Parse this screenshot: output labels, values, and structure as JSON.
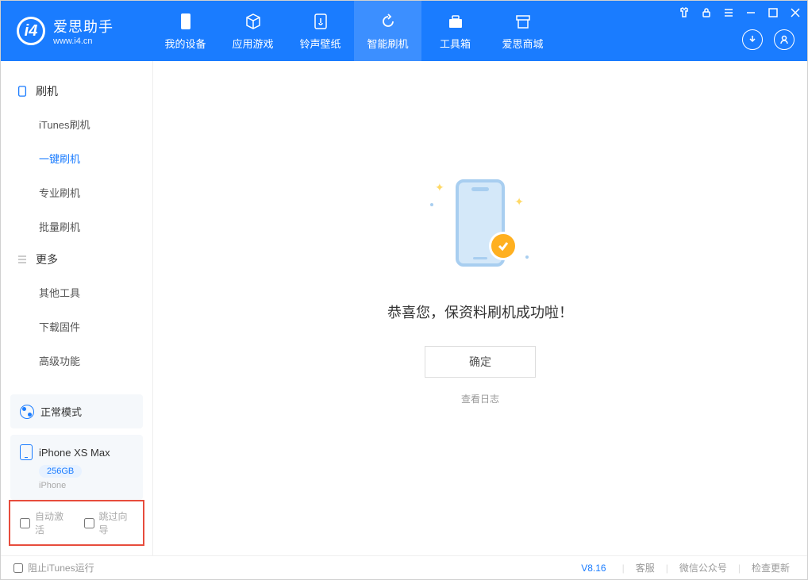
{
  "header": {
    "app_name": "爱思助手",
    "app_url": "www.i4.cn",
    "nav": [
      {
        "label": "我的设备",
        "icon": "device"
      },
      {
        "label": "应用游戏",
        "icon": "cube"
      },
      {
        "label": "铃声壁纸",
        "icon": "music"
      },
      {
        "label": "智能刷机",
        "icon": "refresh",
        "active": true
      },
      {
        "label": "工具箱",
        "icon": "toolbox"
      },
      {
        "label": "爱思商城",
        "icon": "store"
      }
    ]
  },
  "sidebar": {
    "groups": [
      {
        "title": "刷机",
        "icon": "phone",
        "items": [
          "iTunes刷机",
          "一键刷机",
          "专业刷机",
          "批量刷机"
        ],
        "active_index": 1
      },
      {
        "title": "更多",
        "icon": "menu",
        "items": [
          "其他工具",
          "下载固件",
          "高级功能"
        ]
      }
    ],
    "mode_label": "正常模式",
    "device": {
      "name": "iPhone XS Max",
      "storage": "256GB",
      "type": "iPhone"
    },
    "checkboxes": {
      "auto_activate": "自动激活",
      "skip_wizard": "跳过向导"
    }
  },
  "content": {
    "success_message": "恭喜您，保资料刷机成功啦！",
    "confirm_button": "确定",
    "view_log": "查看日志"
  },
  "footer": {
    "block_itunes": "阻止iTunes运行",
    "version": "V8.16",
    "links": [
      "客服",
      "微信公众号",
      "检查更新"
    ]
  }
}
